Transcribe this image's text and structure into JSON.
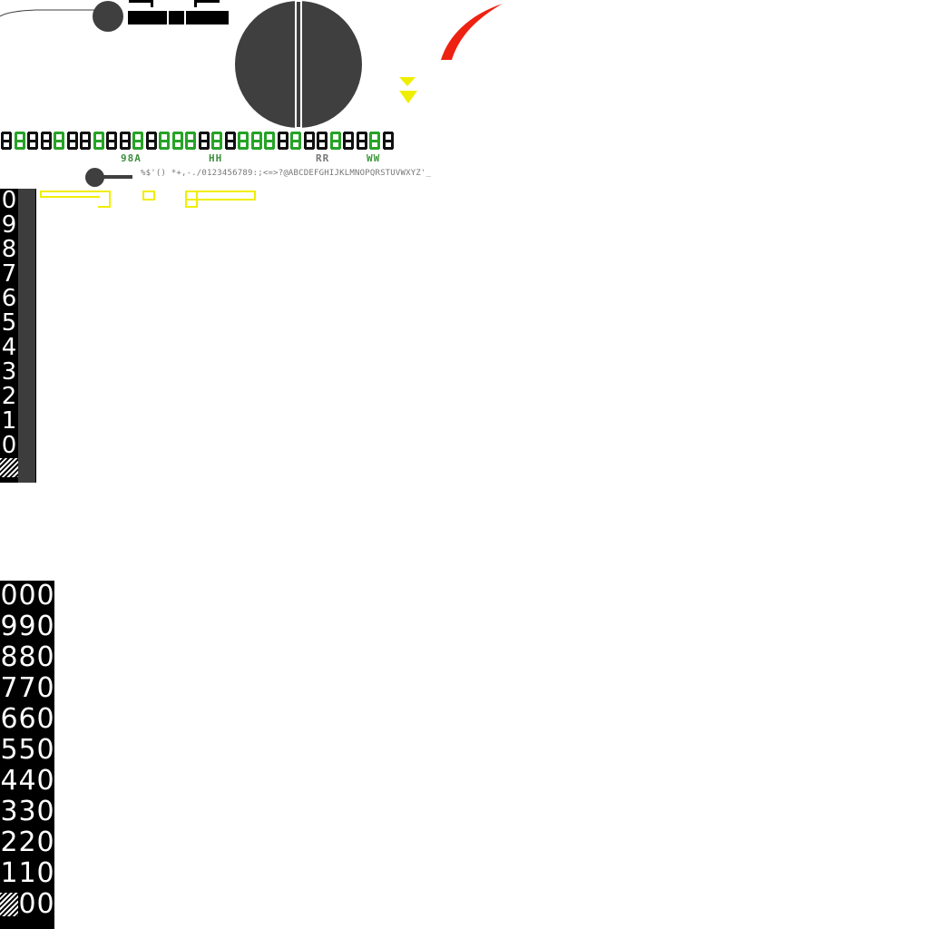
{
  "sprite_sheet": {
    "colors": {
      "panel_black": "#000000",
      "dial_grey": "#3f3f3f",
      "seg_green": "#27a327",
      "seg_black": "#111111",
      "label_green": "#3e8f3e",
      "accent_yellow": "#f0ee00",
      "accent_red": "#ee2211"
    },
    "segment_labels": {
      "group1": "98A",
      "group2": "HH",
      "group3": "RR",
      "group4": "WW"
    },
    "charset_strip": "%$'() *+,-./0123456789:;<=>?@ABCDEFGHIJKLMNOPQRSTUVWXYZ'_",
    "digit_column": [
      "0",
      "9",
      "8",
      "7",
      "6",
      "5",
      "4",
      "3",
      "2",
      "1",
      "0"
    ],
    "odometer_column": [
      [
        "0",
        "0",
        "0"
      ],
      [
        "9",
        "9",
        "0"
      ],
      [
        "8",
        "8",
        "0"
      ],
      [
        "7",
        "7",
        "0"
      ],
      [
        "6",
        "6",
        "0"
      ],
      [
        "5",
        "5",
        "0"
      ],
      [
        "4",
        "4",
        "0"
      ],
      [
        "3",
        "3",
        "0"
      ],
      [
        "2",
        "2",
        "0"
      ],
      [
        "1",
        "1",
        "0"
      ],
      [
        "",
        "0",
        "0"
      ]
    ]
  }
}
